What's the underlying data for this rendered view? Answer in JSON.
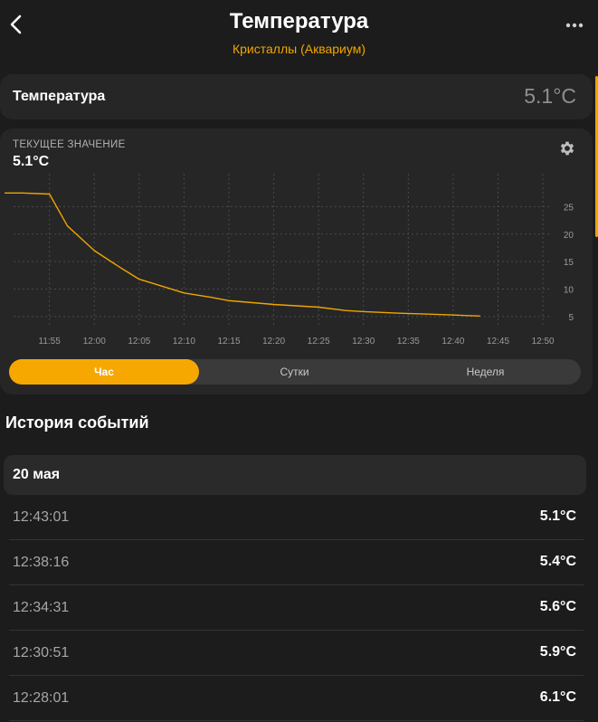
{
  "header": {
    "title": "Температура",
    "subtitle": "Кристаллы (Аквариум)"
  },
  "value_card": {
    "label": "Температура",
    "value": "5.1°C"
  },
  "chart_card": {
    "caption": "ТЕКУЩЕЕ ЗНАЧЕНИЕ",
    "current": "5.1°C",
    "tabs": [
      {
        "label": "Час",
        "active": true
      },
      {
        "label": "Сутки",
        "active": false
      },
      {
        "label": "Неделя",
        "active": false
      }
    ]
  },
  "chart_data": {
    "type": "line",
    "x": [
      "11:50",
      "11:52",
      "11:55",
      "11:57",
      "12:00",
      "12:03",
      "12:05",
      "12:08",
      "12:10",
      "12:13",
      "12:15",
      "12:20",
      "12:25",
      "12:28",
      "12:30",
      "12:34",
      "12:38",
      "12:43"
    ],
    "x_ticks": [
      "11:55",
      "12:00",
      "12:05",
      "12:10",
      "12:15",
      "12:20",
      "12:25",
      "12:30",
      "12:35",
      "12:40",
      "12:45",
      "12:50"
    ],
    "series": [
      {
        "values": [
          27.5,
          27.5,
          27.3,
          21.5,
          17.0,
          13.8,
          11.8,
          10.3,
          9.3,
          8.5,
          7.9,
          7.2,
          6.7,
          6.1,
          5.9,
          5.6,
          5.4,
          5.1
        ]
      }
    ],
    "y_ticks": [
      "5",
      "10",
      "15",
      "20",
      "25"
    ],
    "ylim": [
      3,
      31
    ],
    "xlim": [
      "11:51",
      "12:51"
    ],
    "color": "#f0a500",
    "grid": true
  },
  "history": {
    "title": "История событий",
    "day": "20 мая",
    "rows": [
      {
        "time": "12:43:01",
        "value": "5.1°C"
      },
      {
        "time": "12:38:16",
        "value": "5.4°C"
      },
      {
        "time": "12:34:31",
        "value": "5.6°C"
      },
      {
        "time": "12:30:51",
        "value": "5.9°C"
      },
      {
        "time": "12:28:01",
        "value": "6.1°C"
      }
    ]
  },
  "colors": {
    "accent": "#f0a500",
    "background": "#1c1c1c",
    "card": "#262626"
  }
}
